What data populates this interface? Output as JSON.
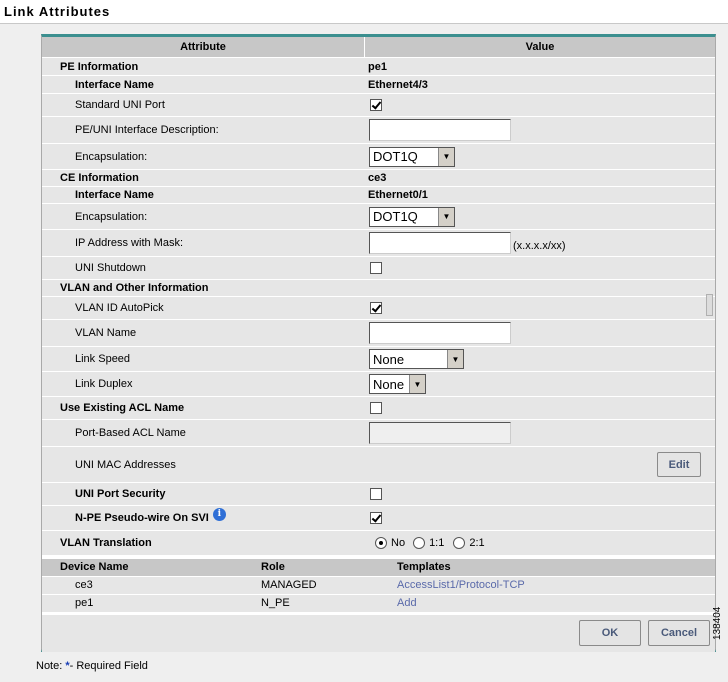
{
  "window": {
    "title": "Link Attributes"
  },
  "table": {
    "col_attribute": "Attribute",
    "col_value": "Value",
    "pe_info_label": "PE Information",
    "pe_info_value": "pe1",
    "pe_iface_label": "Interface Name",
    "pe_iface_value": "Ethernet4/3",
    "std_uni_label": "Standard UNI Port",
    "pe_uni_desc_label": "PE/UNI Interface Description:",
    "pe_encap_label": "Encapsulation:",
    "pe_encap_value": "DOT1Q",
    "ce_info_label": "CE Information",
    "ce_info_value": "ce3",
    "ce_iface_label": "Interface Name",
    "ce_iface_value": "Ethernet0/1",
    "ce_encap_label": "Encapsulation:",
    "ce_encap_value": "DOT1Q",
    "ip_label": "IP Address with Mask:",
    "ip_hint": "(x.x.x.x/xx)",
    "uni_shutdown_label": "UNI Shutdown",
    "vlan_other_label": "VLAN and Other Information",
    "vlan_autopick_label": "VLAN ID AutoPick",
    "vlan_name_label": "VLAN Name",
    "link_speed_label": "Link Speed",
    "link_speed_value": "None",
    "link_duplex_label": "Link Duplex",
    "link_duplex_value": "None",
    "use_acl_label": "Use Existing ACL Name",
    "port_acl_label": "Port-Based ACL Name",
    "uni_mac_label": "UNI MAC Addresses",
    "edit_label": "Edit",
    "uni_port_sec_label": "UNI Port Security",
    "npe_label": "N-PE Pseudo-wire On SVI",
    "info_icon_glyph": "i",
    "vlan_trans_label": "VLAN Translation",
    "vlan_trans_opts": [
      "No",
      "1:1",
      "2:1"
    ]
  },
  "devices": {
    "col_name": "Device Name",
    "col_role": "Role",
    "col_templates": "Templates",
    "rows": [
      {
        "name": "ce3",
        "role": "MANAGED",
        "template": "AccessList1/Protocol-TCP"
      },
      {
        "name": "pe1",
        "role": "N_PE",
        "template": "Add"
      }
    ]
  },
  "buttons": {
    "ok": "OK",
    "cancel": "Cancel"
  },
  "footer": {
    "note_prefix": "Note: ",
    "note_star": "*",
    "note_suffix": "- Required Field",
    "figure_number": "138404"
  },
  "checkbox_state": {
    "standard_uni_port": true,
    "uni_shutdown": false,
    "vlan_autopick": true,
    "use_existing_acl": false,
    "uni_port_security": false,
    "npe_pseudowire": true
  },
  "vlan_translation_selected": "No"
}
